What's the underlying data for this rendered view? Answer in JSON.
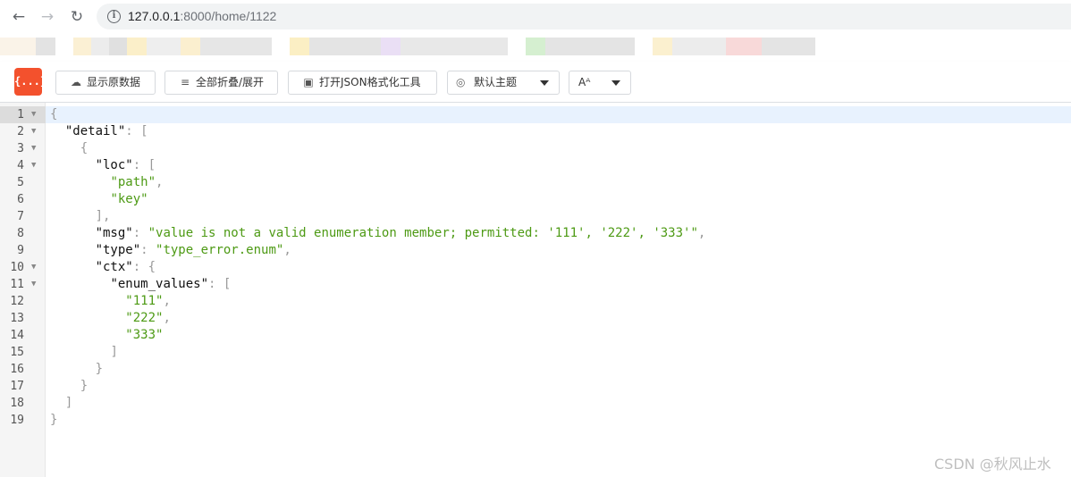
{
  "browser": {
    "url_host": "127.0.0.1",
    "url_rest": ":8000/home/1122"
  },
  "toolbar": {
    "logo_text": "{...}",
    "raw_button": "显示原数据",
    "fold_button": "全部折叠/展开",
    "json_tool_button": "打开JSON格式化工具",
    "theme_select": "默认主题",
    "font_select": "Aᴬ"
  },
  "colors": {
    "logo_bg": "#f3512d",
    "string": "#4d9a14",
    "active_line": "#e8f2fe"
  },
  "icons": {
    "back": "arrow-left-icon",
    "forward": "arrow-right-icon",
    "reload": "reload-icon",
    "info": "info-icon",
    "cloud": "cloud-icon",
    "fold": "fold-icon",
    "json_tool": "json-file-icon",
    "theme": "palette-icon"
  },
  "code_lines": [
    {
      "n": "1",
      "fold": true,
      "indent": 0,
      "parts": [
        [
          "p",
          "{"
        ]
      ]
    },
    {
      "n": "2",
      "fold": true,
      "indent": 1,
      "parts": [
        [
          "k",
          "\"detail\""
        ],
        [
          "p",
          ": ["
        ]
      ]
    },
    {
      "n": "3",
      "fold": true,
      "indent": 2,
      "parts": [
        [
          "p",
          "{"
        ]
      ]
    },
    {
      "n": "4",
      "fold": true,
      "indent": 3,
      "parts": [
        [
          "k",
          "\"loc\""
        ],
        [
          "p",
          ": ["
        ]
      ]
    },
    {
      "n": "5",
      "fold": false,
      "indent": 4,
      "parts": [
        [
          "s",
          "\"path\""
        ],
        [
          "p",
          ","
        ]
      ]
    },
    {
      "n": "6",
      "fold": false,
      "indent": 4,
      "parts": [
        [
          "s",
          "\"key\""
        ]
      ]
    },
    {
      "n": "7",
      "fold": false,
      "indent": 3,
      "parts": [
        [
          "p",
          "],"
        ]
      ]
    },
    {
      "n": "8",
      "fold": false,
      "indent": 3,
      "parts": [
        [
          "k",
          "\"msg\""
        ],
        [
          "p",
          ": "
        ],
        [
          "s",
          "\"value is not a valid enumeration member; permitted: '111', '222', '333'\""
        ],
        [
          "p",
          ","
        ]
      ]
    },
    {
      "n": "9",
      "fold": false,
      "indent": 3,
      "parts": [
        [
          "k",
          "\"type\""
        ],
        [
          "p",
          ": "
        ],
        [
          "s",
          "\"type_error.enum\""
        ],
        [
          "p",
          ","
        ]
      ]
    },
    {
      "n": "10",
      "fold": true,
      "indent": 3,
      "parts": [
        [
          "k",
          "\"ctx\""
        ],
        [
          "p",
          ": {"
        ]
      ]
    },
    {
      "n": "11",
      "fold": true,
      "indent": 4,
      "parts": [
        [
          "k",
          "\"enum_values\""
        ],
        [
          "p",
          ": ["
        ]
      ]
    },
    {
      "n": "12",
      "fold": false,
      "indent": 5,
      "parts": [
        [
          "s",
          "\"111\""
        ],
        [
          "p",
          ","
        ]
      ]
    },
    {
      "n": "13",
      "fold": false,
      "indent": 5,
      "parts": [
        [
          "s",
          "\"222\""
        ],
        [
          "p",
          ","
        ]
      ]
    },
    {
      "n": "14",
      "fold": false,
      "indent": 5,
      "parts": [
        [
          "s",
          "\"333\""
        ]
      ]
    },
    {
      "n": "15",
      "fold": false,
      "indent": 4,
      "parts": [
        [
          "p",
          "]"
        ]
      ]
    },
    {
      "n": "16",
      "fold": false,
      "indent": 3,
      "parts": [
        [
          "p",
          "}"
        ]
      ]
    },
    {
      "n": "17",
      "fold": false,
      "indent": 2,
      "parts": [
        [
          "p",
          "}"
        ]
      ]
    },
    {
      "n": "18",
      "fold": false,
      "indent": 1,
      "parts": [
        [
          "p",
          "]"
        ]
      ]
    },
    {
      "n": "19",
      "fold": false,
      "indent": 0,
      "parts": [
        [
          "p",
          "}"
        ]
      ]
    }
  ],
  "watermark": "CSDN @秋风止水"
}
